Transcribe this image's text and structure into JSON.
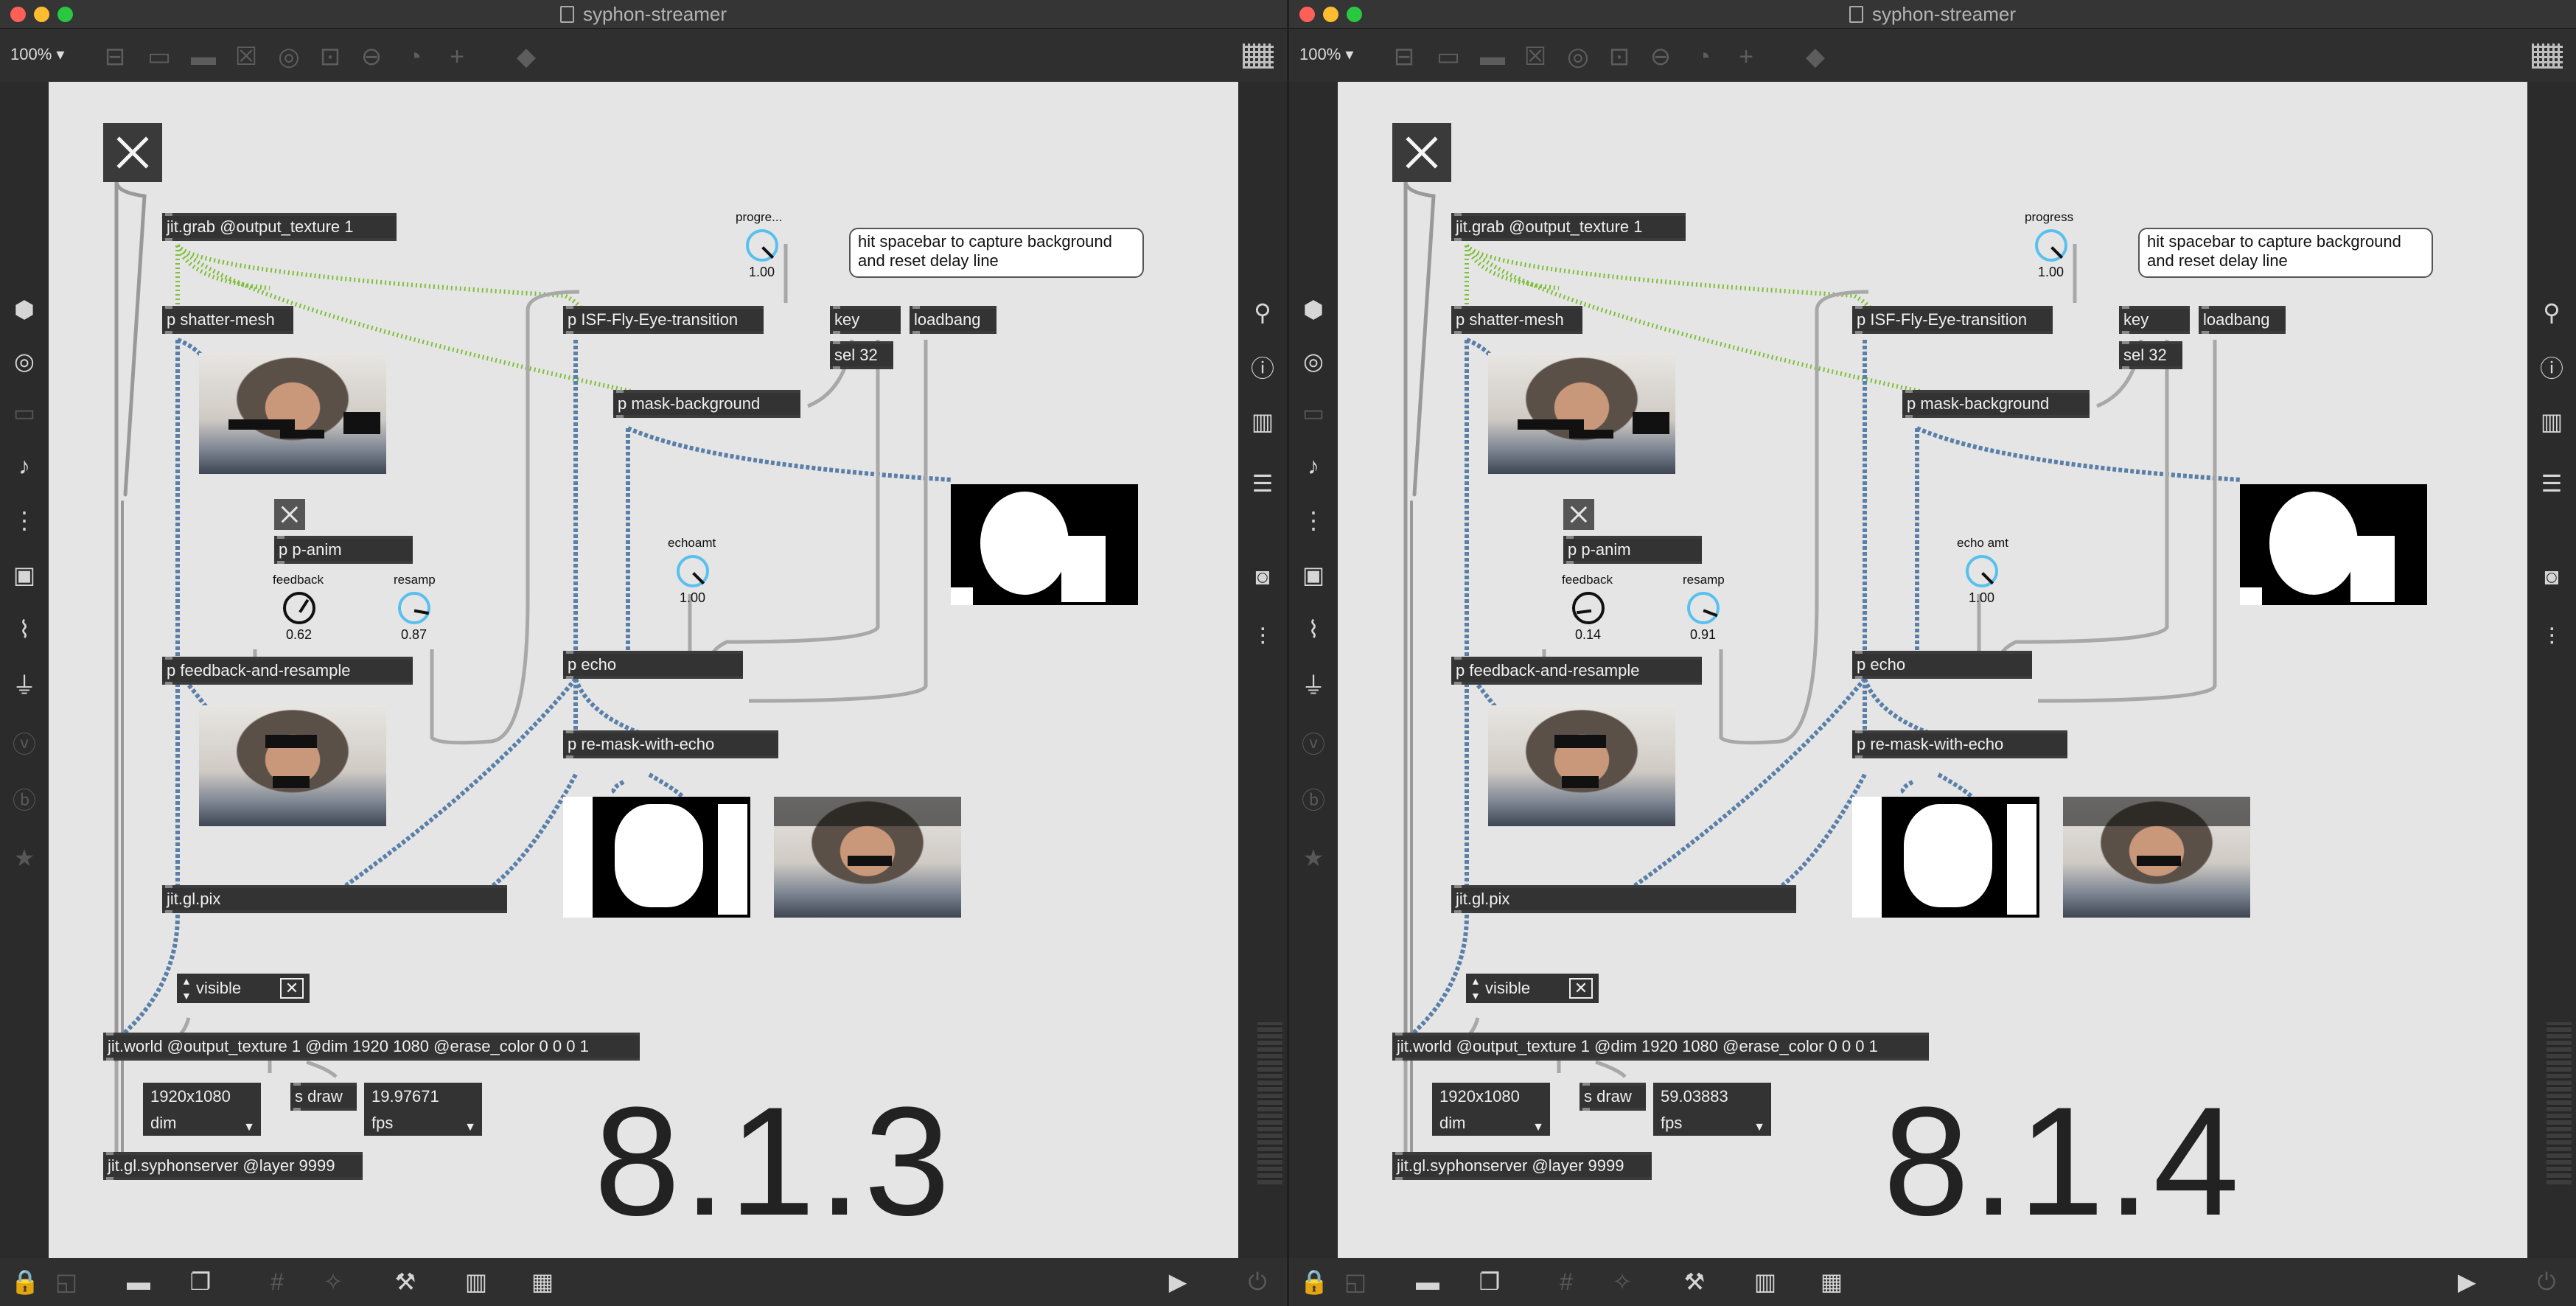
{
  "windows": [
    {
      "title": "syphon-streamer",
      "zoom": "100%",
      "objects": {
        "grab": "jit.grab @output_texture 1",
        "shatter": "p shatter-mesh",
        "isf": "p ISF-Fly-Eye-transition",
        "key": "key",
        "loadbang": "loadbang",
        "sel": "sel 32",
        "mask": "p mask-background",
        "panim": "p p-anim",
        "feedback_resample": "p feedback-and-resample",
        "echo": "p echo",
        "remask": "p re-mask-with-echo",
        "glpix": "jit.gl.pix",
        "world": "jit.world @output_texture 1 @dim 1920 1080 @erase_color 0 0 0 1",
        "syphon": "jit.gl.syphonserver @layer 9999",
        "sdraw": "s draw"
      },
      "comment": "hit spacebar to capture background and reset delay line",
      "dials": {
        "progress": {
          "label": "progre...",
          "value": "1.00",
          "level": 1.0
        },
        "echoamt": {
          "label": "echoamt",
          "value": "1.00",
          "level": 1.0
        },
        "feedback": {
          "label": "feedback",
          "value": "0.62",
          "level": 0.62
        },
        "resamp": {
          "label": "resamp",
          "value": "0.87",
          "level": 0.87
        }
      },
      "visible_label": "visible",
      "dim_value": "1920x1080",
      "dim_menu": "dim",
      "fps_value": "19.97671",
      "fps_menu": "fps",
      "version": "8.1.3"
    },
    {
      "title": "syphon-streamer",
      "zoom": "100%",
      "objects": {
        "grab": "jit.grab @output_texture 1",
        "shatter": "p shatter-mesh",
        "isf": "p ISF-Fly-Eye-transition",
        "key": "key",
        "loadbang": "loadbang",
        "sel": "sel 32",
        "mask": "p mask-background",
        "panim": "p p-anim",
        "feedback_resample": "p feedback-and-resample",
        "echo": "p echo",
        "remask": "p re-mask-with-echo",
        "glpix": "jit.gl.pix",
        "world": "jit.world @output_texture 1 @dim 1920 1080 @erase_color 0 0 0 1",
        "syphon": "jit.gl.syphonserver @layer 9999",
        "sdraw": "s draw"
      },
      "comment": "hit spacebar to capture background and reset delay line",
      "dials": {
        "progress": {
          "label": "progress",
          "value": "1.00",
          "level": 1.0
        },
        "echoamt": {
          "label": "echo amt",
          "value": "1.00",
          "level": 1.0
        },
        "feedback": {
          "label": "feedback",
          "value": "0.14",
          "level": 0.14
        },
        "resamp": {
          "label": "resamp",
          "value": "0.91",
          "level": 0.91
        }
      },
      "visible_label": "visible",
      "dim_value": "1920x1080",
      "dim_menu": "dim",
      "fps_value": "59.03883",
      "fps_menu": "fps",
      "version": "8.1.4"
    }
  ],
  "icons": {
    "left_sidebar": [
      "cube-icon",
      "target-icon",
      "film-icon",
      "note-icon",
      "sequence-icon",
      "image-icon",
      "paperclip-icon",
      "plug-icon",
      "v-icon",
      "b-icon",
      "star-icon"
    ],
    "right_sidebar": [
      "search-icon",
      "info-icon",
      "book-icon",
      "list-icon",
      "camera-icon",
      "mixer-icon"
    ],
    "bottom": [
      "lock-icon",
      "presentation-icon",
      "comment-icon",
      "windows-icon",
      "grid-icon",
      "wand-icon",
      "wrench-icon",
      "piano-icon",
      "keyboard-icon",
      "play-icon",
      "power-icon"
    ]
  }
}
